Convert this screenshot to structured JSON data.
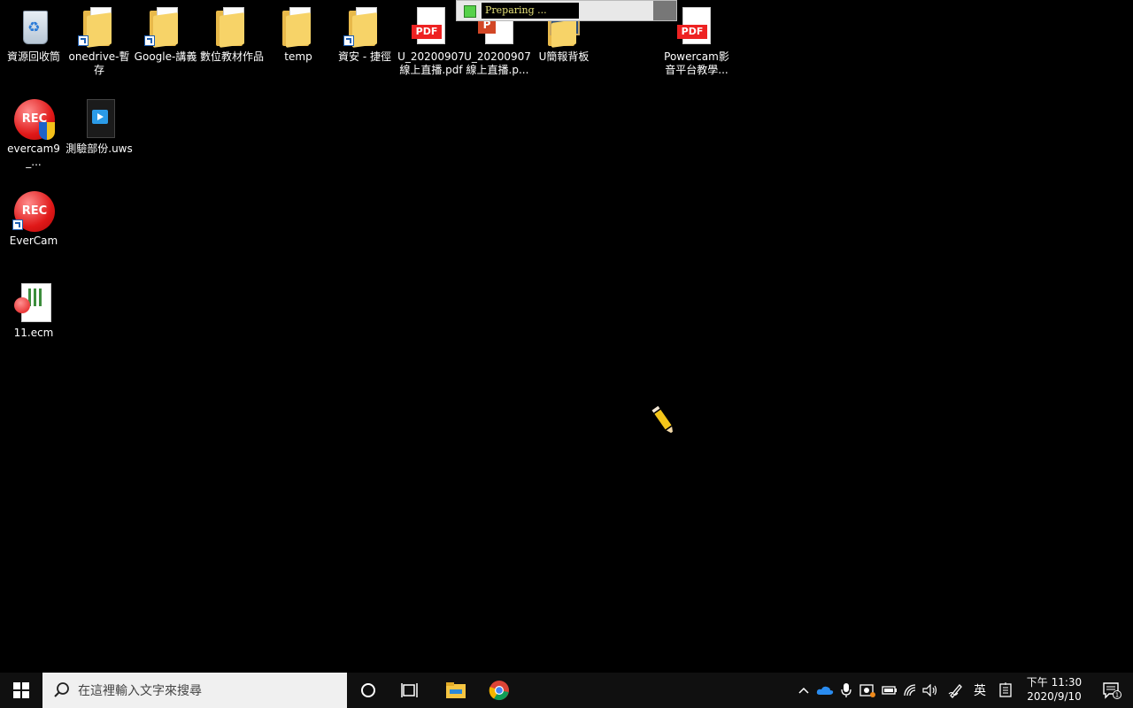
{
  "desktop_icons": [
    {
      "label": "資源回收筒"
    },
    {
      "label": "onedrive-暫存"
    },
    {
      "label": "Google-講義"
    },
    {
      "label": "數位教材作品"
    },
    {
      "label": "temp"
    },
    {
      "label": "資安 - 捷徑"
    },
    {
      "label": "U_20200907線上直播.pdf",
      "badge": "PDF"
    },
    {
      "label": "U_20200907線上直播.p...",
      "badge": "P"
    },
    {
      "label": "U簡報背板"
    },
    {
      "label": "Powercam影音平台教學...",
      "badge": "PDF"
    },
    {
      "label": "evercam9_...",
      "badge": "REC"
    },
    {
      "label": "測驗部份.uws"
    },
    {
      "label": "EverCam",
      "badge": "REC"
    },
    {
      "label": "11.ecm"
    }
  ],
  "progress": {
    "text": "Preparing ...",
    "indicator_color": "#56d14a"
  },
  "taskbar": {
    "search_placeholder": "在這裡輸入文字來搜尋",
    "ime_label": "英",
    "clock_time": "下午 11:30",
    "clock_date": "2020/9/10",
    "notification_count": "1"
  },
  "colors": {
    "desktop": "#000000",
    "taskbar": "#101010",
    "pdf_red": "#e22222",
    "rec_red": "#e01818"
  }
}
